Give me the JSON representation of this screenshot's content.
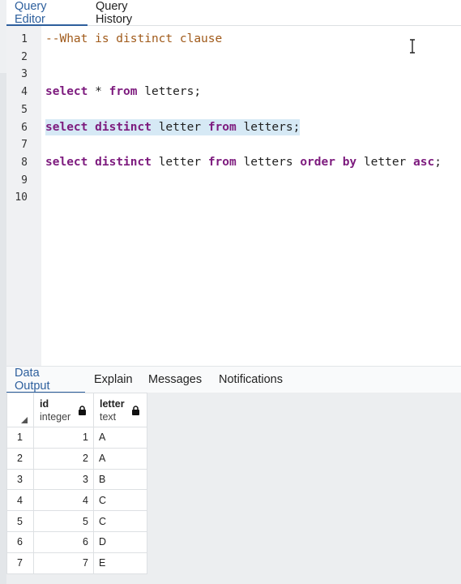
{
  "editor_tabs": [
    "Query Editor",
    "Query History"
  ],
  "code_lines": [
    {
      "no": "1"
    },
    {
      "no": "2"
    },
    {
      "no": "3"
    },
    {
      "no": "4"
    },
    {
      "no": "5"
    },
    {
      "no": "6"
    },
    {
      "no": "7"
    },
    {
      "no": "8"
    },
    {
      "no": "9"
    },
    {
      "no": "10"
    }
  ],
  "code": {
    "line1": "--What is distinct clause",
    "line4": [
      "select",
      " * ",
      "from",
      " letters;"
    ],
    "line6": [
      "select",
      " ",
      "distinct",
      " letter ",
      "from",
      " letters;"
    ],
    "line8": [
      "select",
      " ",
      "distinct",
      " letter ",
      "from",
      " letters ",
      "order",
      " ",
      "by",
      " letter ",
      "asc",
      ";"
    ]
  },
  "output_tabs": [
    "Data Output",
    "Explain",
    "Messages",
    "Notifications"
  ],
  "grid": {
    "columns": [
      {
        "name": "id",
        "type": "integer"
      },
      {
        "name": "letter",
        "type": "text"
      }
    ],
    "rows": [
      {
        "n": "1",
        "id": "1",
        "letter": "A"
      },
      {
        "n": "2",
        "id": "2",
        "letter": "A"
      },
      {
        "n": "3",
        "id": "3",
        "letter": "B"
      },
      {
        "n": "4",
        "id": "4",
        "letter": "C"
      },
      {
        "n": "5",
        "id": "5",
        "letter": "C"
      },
      {
        "n": "6",
        "id": "6",
        "letter": "D"
      },
      {
        "n": "7",
        "id": "7",
        "letter": "E"
      }
    ]
  },
  "colors": {
    "accent": "#2d5f9d",
    "keyword": "#7d1b7e",
    "comment": "#a05a1a",
    "highlight": "#d6e9f5"
  }
}
